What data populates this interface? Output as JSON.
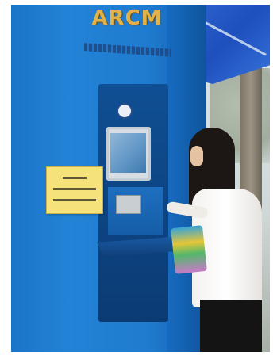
{
  "kiosk": {
    "title": "ARCM"
  },
  "colors": {
    "kiosk_blue": "#1f7bcf",
    "title_gold": "#e2b24a",
    "sign_yellow": "#f5e27a",
    "canopy_blue": "#2f66d1"
  }
}
